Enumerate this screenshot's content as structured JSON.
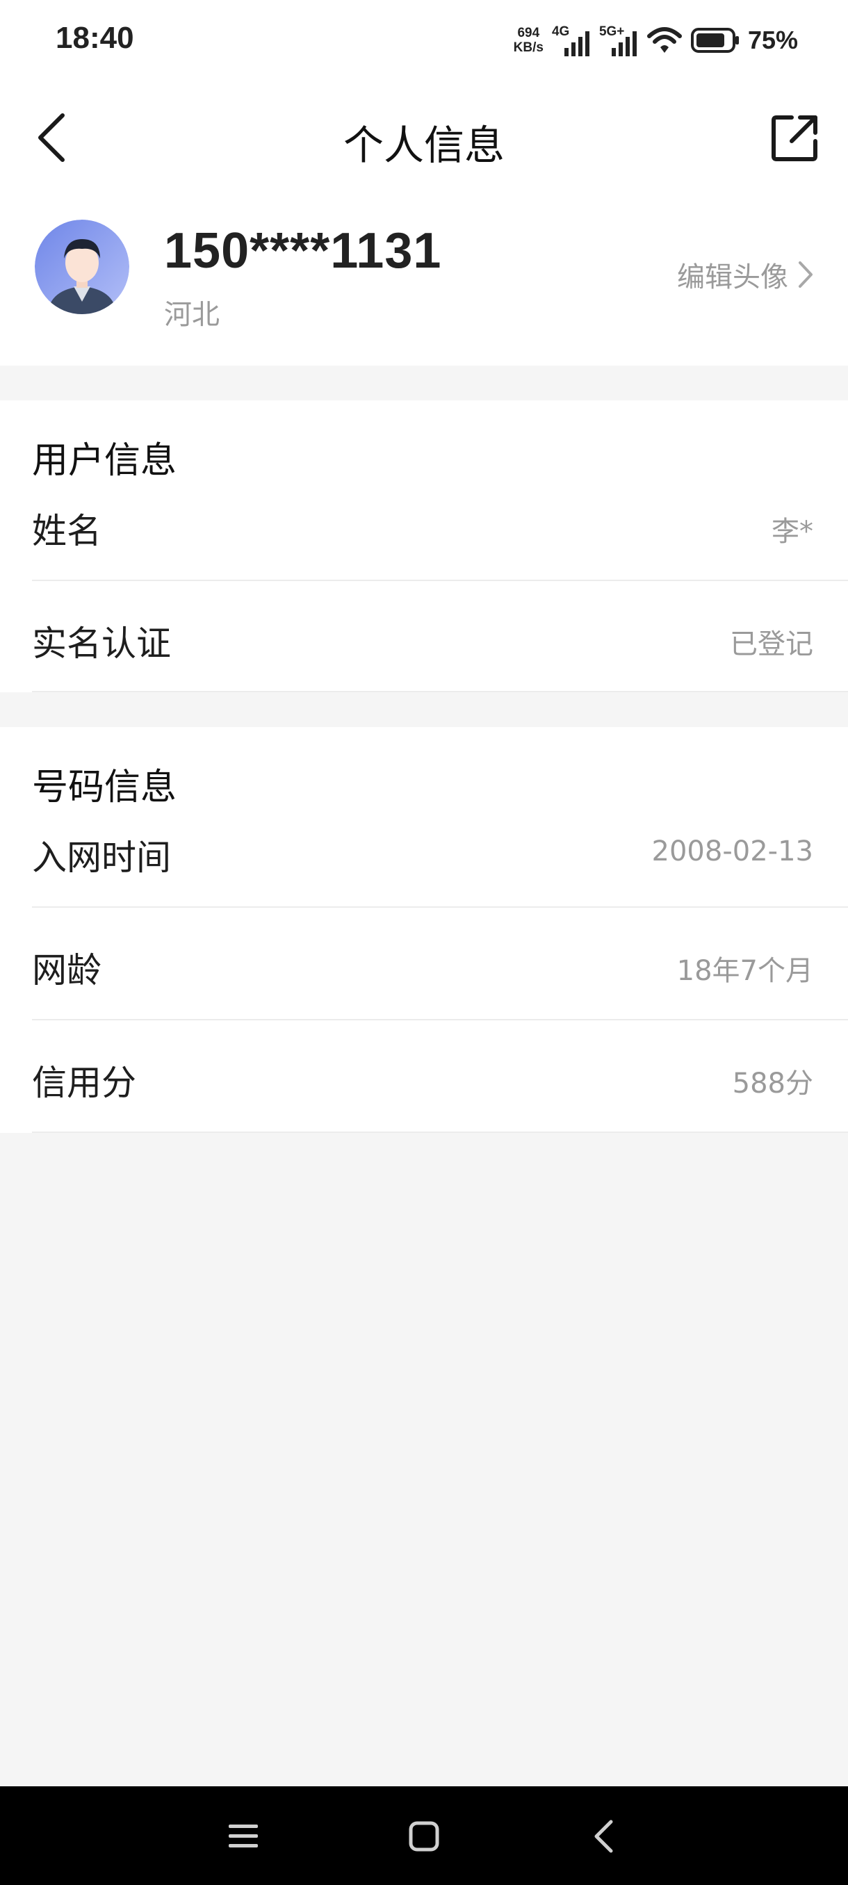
{
  "status_bar": {
    "time": "18:40",
    "net_speed_value": "694",
    "net_speed_unit": "KB/s",
    "sim1_tag": "4G",
    "sim2_tag": "5G+",
    "battery_percent": "75%"
  },
  "nav": {
    "title": "个人信息",
    "back_icon": "chevron-left-icon",
    "share_icon": "share-out-icon"
  },
  "profile": {
    "phone": "150****1131",
    "region": "河北",
    "edit_avatar_label": "编辑头像"
  },
  "user_info": {
    "title": "用户信息",
    "rows": [
      {
        "label": "姓名",
        "value": "李*"
      },
      {
        "label": "实名认证",
        "value": "已登记"
      }
    ]
  },
  "number_info": {
    "title": "号码信息",
    "rows": [
      {
        "label": "入网时间",
        "value": "2008-02-13"
      },
      {
        "label": "网龄",
        "value": "18年7个月"
      },
      {
        "label": "信用分",
        "value": "588分"
      }
    ]
  },
  "colors": {
    "background": "#f5f5f5",
    "card": "#ffffff",
    "muted_text": "#9a9a9a",
    "avatar_bg": "#8fa0f0"
  }
}
